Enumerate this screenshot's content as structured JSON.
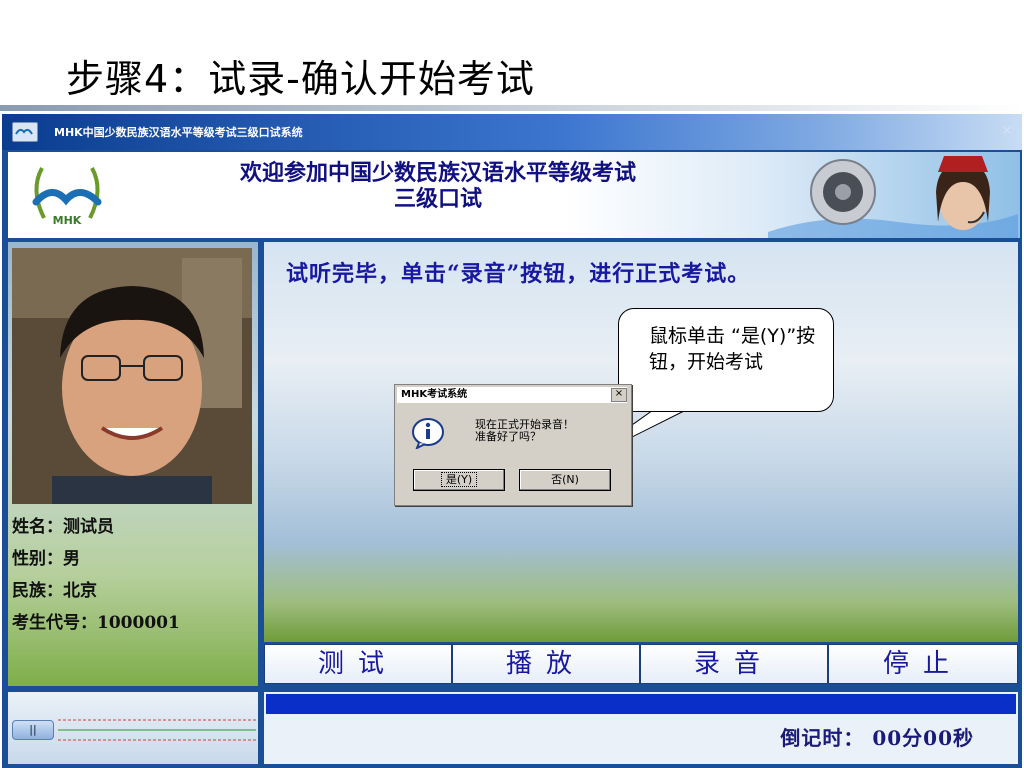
{
  "slide": {
    "title": "步骤4：试录-确认开始考试"
  },
  "window": {
    "title": "MHK中国少数民族汉语水平等级考试三级口试系统",
    "close": "×",
    "banner": {
      "line1": "欢迎参加中国少数民族汉语水平等级考试",
      "line2": "三级口试",
      "logo": "MHK"
    },
    "examinee": {
      "name_label": "姓名：测试员",
      "gender_label": "性别：男",
      "ethnicity_label": "民族：北京",
      "id_label": "考生代号：1000001"
    },
    "instruction": "试听完毕，单击“录音”按钮，进行正式考试。",
    "toolbar": {
      "test": "测试",
      "play": "播放",
      "record": "录音",
      "stop": "停止"
    },
    "status": {
      "pause_label": "||",
      "timer": "倒记时： 00分00秒"
    }
  },
  "dialog": {
    "title": "MHK考试系统",
    "close": "×",
    "message_line1": "现在正式开始录音！",
    "message_line2": "准备好了吗？",
    "yes": "是(Y)",
    "no": "否(N)"
  },
  "callout": {
    "text": "鼠标单击 “是(Y)”按钮，开始考试"
  },
  "colors": {
    "accent": "#1818a0",
    "titlebar": "#0a3d8f",
    "progress": "#0a2ec8"
  }
}
